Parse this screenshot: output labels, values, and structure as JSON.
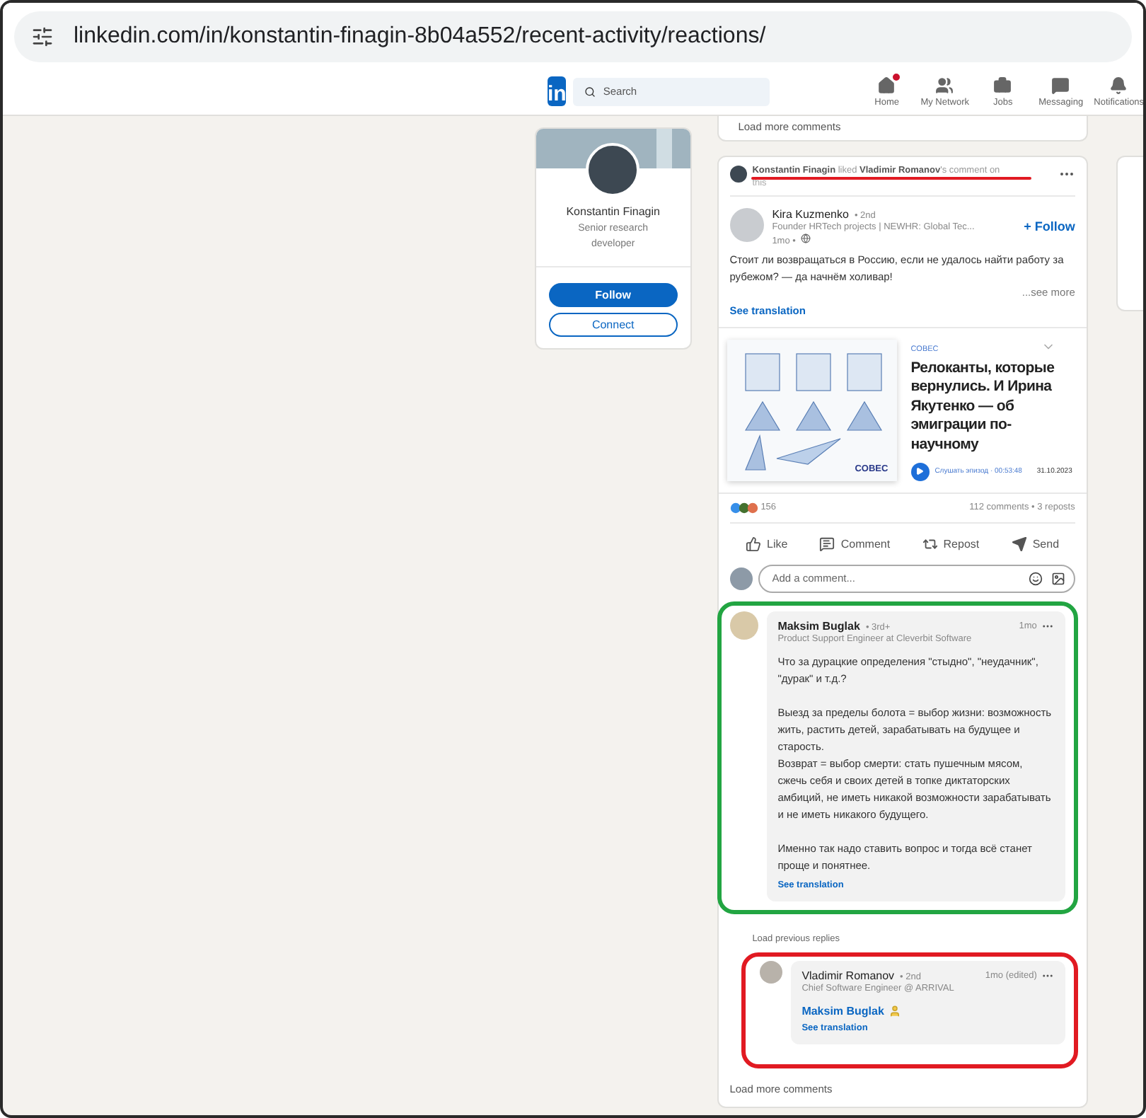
{
  "browser": {
    "url": "linkedin.com/in/konstantin-finagin-8b04a552/recent-activity/reactions/"
  },
  "nav": {
    "logo": "in",
    "search": {
      "placeholder": "Search"
    },
    "items": [
      {
        "kind": "home",
        "label": "Home",
        "notification": true
      },
      {
        "kind": "network",
        "label": "My Network",
        "notification": false
      },
      {
        "kind": "jobs",
        "label": "Jobs",
        "notification": false
      },
      {
        "kind": "messaging",
        "label": "Messaging",
        "notification": false
      },
      {
        "kind": "notifications",
        "label": "Notifications",
        "notification": false
      }
    ]
  },
  "profile": {
    "name": "Konstantin Finagin",
    "headline": "Senior research developer",
    "buttons": [
      {
        "kind": "primary",
        "label": "Follow"
      },
      {
        "kind": "secondary",
        "label": "Connect"
      }
    ]
  },
  "previous_card": {
    "link": "Load more comments"
  },
  "post": {
    "activity": "**Konstantin Finagin** liked **Vladimir Romanov**'s comment on",
    "activity_overflow": "this",
    "author": {
      "name": "Kira Kuzmenko",
      "degree": "• 2nd",
      "headline": "Founder HRTech projects | NEWHR: Global Tec...",
      "time": "1mo •"
    },
    "follow": "+ Follow",
    "text": "Стоит ли возвращаться в Россию, если не удалось найти работу за рубежом? — да начнём холивар!",
    "see_more": "...see more",
    "see_translation": "See translation",
    "article": {
      "image_label": "COBEC",
      "source": "COBEC",
      "title": "Релоканты, которые вернулись. И Ирина Якутенко — об эмиграции по-научному",
      "listen": "Слушать эпизод · 00:53:48",
      "date": "31.10.2023"
    },
    "reactions": "156",
    "stats": "112 comments • 3 reposts",
    "actions": [
      {
        "kind": "like",
        "label": "Like"
      },
      {
        "kind": "comment",
        "label": "Comment"
      },
      {
        "kind": "repost",
        "label": "Repost"
      },
      {
        "kind": "send",
        "label": "Send"
      }
    ],
    "comment_input": {
      "placeholder": "Add a comment..."
    },
    "comment": {
      "name": "Maksim Buglak",
      "degree": "• 3rd+",
      "headline": "Product Support Engineer at Cleverbit Software",
      "time": "1mo",
      "paragraphs": [
        "Что за дурацкие определения \"стыдно\", \"неудачник\", \"дурак\" и т.д.?",
        "Выезд за пределы болота = выбор жизни: возможность жить, растить детей, зарабатывать на будущее и старость.\nВозврат = выбор смерти: стать пушечным мясом, сжечь себя и своих детей в топке диктаторских амбиций, не иметь никакой возможности зарабатывать и не иметь никакого будущего.",
        "Именно так надо ставить вопрос и тогда всё станет проще и понятнее."
      ],
      "see_translation": "See translation"
    },
    "load_previous": "Load previous replies",
    "reply": {
      "name": "Vladimir Romanov",
      "degree": "• 2nd",
      "headline": "Chief Software Engineer @ ARRIVAL",
      "time": "1mo (edited)",
      "mention": "Maksim Buglak",
      "see_translation": "See translation"
    },
    "load_more": "Load more comments"
  }
}
